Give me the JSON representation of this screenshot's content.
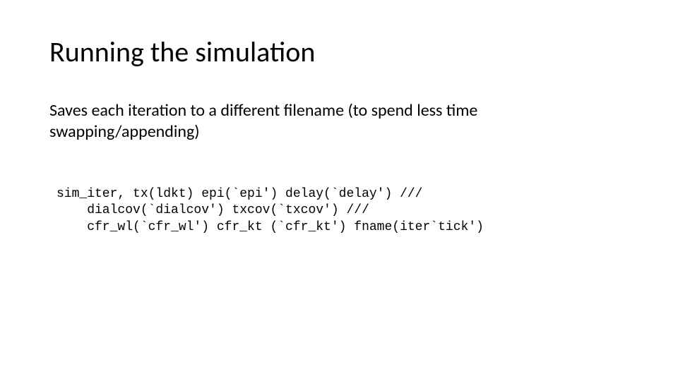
{
  "slide": {
    "title": "Running the simulation",
    "body": "Saves each iteration to a different filename (to spend less time swapping/appending)",
    "code": {
      "line1": "sim_iter, tx(ldkt) epi(`epi') delay(`delay') ///",
      "line2": "    dialcov(`dialcov') txcov(`txcov') ///",
      "line3": "    cfr_wl(`cfr_wl') cfr_kt (`cfr_kt') fname(iter`tick')"
    }
  }
}
